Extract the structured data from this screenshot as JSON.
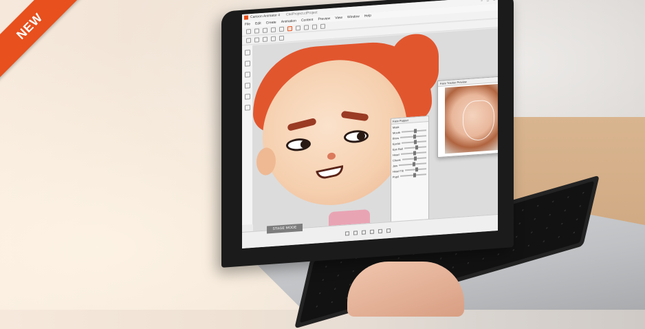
{
  "banner": {
    "label": "NEW",
    "color": "#e8501d"
  },
  "app": {
    "title": "Cartoon Animator 4",
    "document": "Cte/Project.ctProject",
    "window_controls": [
      "−",
      "□",
      "×"
    ]
  },
  "menu": [
    "File",
    "Edit",
    "Create",
    "Animation",
    "Content",
    "Preview",
    "View",
    "Window",
    "Help"
  ],
  "face_panel": {
    "title": "Face Puppet",
    "tab": "Mask",
    "rows": [
      "Mouth",
      "Brow",
      "Eyelid",
      "Eye Ball",
      "Head",
      "Cheek",
      "Jaw",
      "Head Tilt",
      "Pupil"
    ]
  },
  "preview_window": {
    "title": "Face Tracker Preview"
  },
  "stage_mode_button": "STAGE MODE",
  "icons": {
    "new": "file-icon",
    "open": "folder-icon",
    "save": "save-icon",
    "select": "cursor-icon",
    "move": "move-icon",
    "rotate": "rotate-icon"
  }
}
